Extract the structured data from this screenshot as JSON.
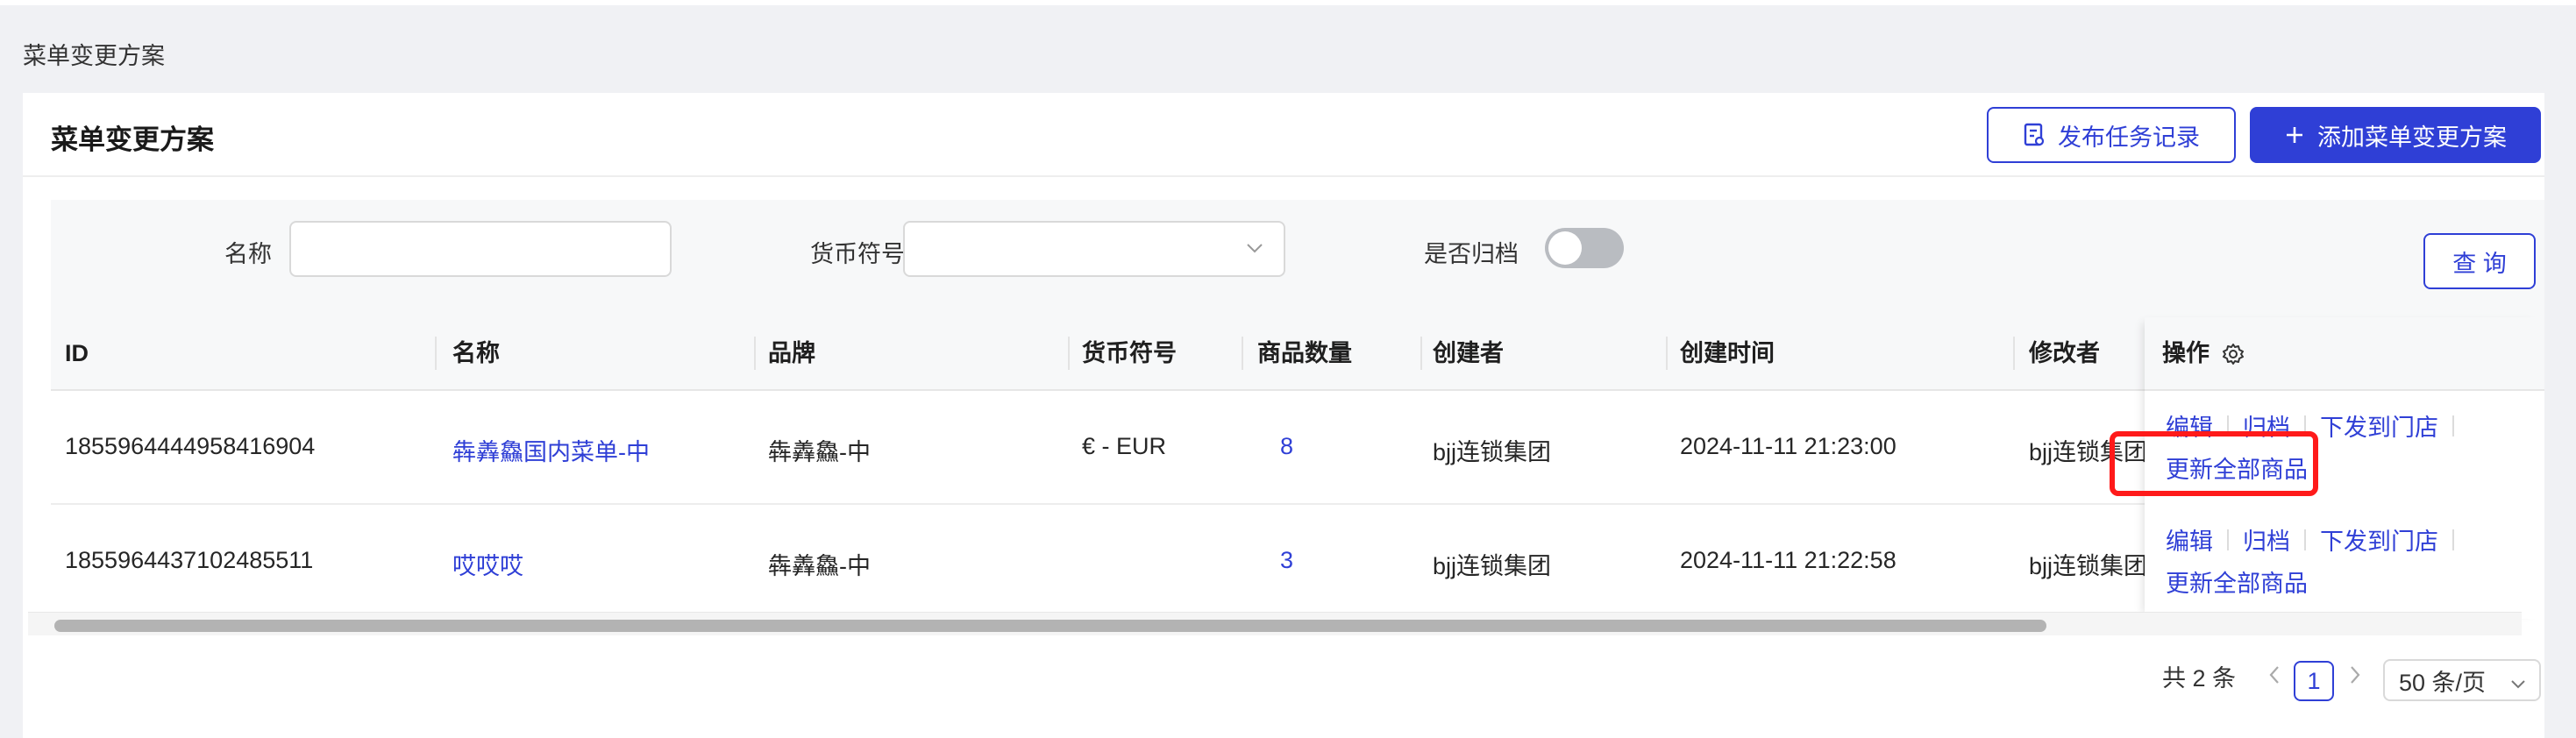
{
  "breadcrumb": "菜单变更方案",
  "header": {
    "title": "菜单变更方案",
    "publish_button": "发布任务记录",
    "add_button": "添加菜单变更方案"
  },
  "filters": {
    "name_label": "名称",
    "name_value": "",
    "currency_label": "货币符号",
    "currency_value": "",
    "archived_label": "是否归档",
    "archived_on": false,
    "query_button": "查 询"
  },
  "table": {
    "columns": [
      "ID",
      "名称",
      "品牌",
      "货币符号",
      "商品数量",
      "创建者",
      "创建时间",
      "修改者",
      "操作"
    ],
    "rows": [
      {
        "id": "1855964444958416904",
        "name": "犇羴鱻国内菜单-中",
        "brand": "犇羴鱻-中",
        "currency": "€ - EUR",
        "count": "8",
        "creator": "bjj连锁集团",
        "created": "2024-11-11 21:23:00",
        "modifier": "bjj连锁集团"
      },
      {
        "id": "1855964437102485511",
        "name": "哎哎哎",
        "brand": "犇羴鱻-中",
        "currency": "",
        "count": "3",
        "creator": "bjj连锁集团",
        "created": "2024-11-11 21:22:58",
        "modifier": "bjj连锁集团"
      }
    ],
    "actions": {
      "edit": "编辑",
      "archive": "归档",
      "dispatch": "下发到门店",
      "update_all": "更新全部商品"
    }
  },
  "pagination": {
    "total": "共 2 条",
    "current_page": "1",
    "page_size": "50 条/页"
  },
  "colors": {
    "primary": "#2f3fd6",
    "highlight": "#ff1a1a"
  }
}
